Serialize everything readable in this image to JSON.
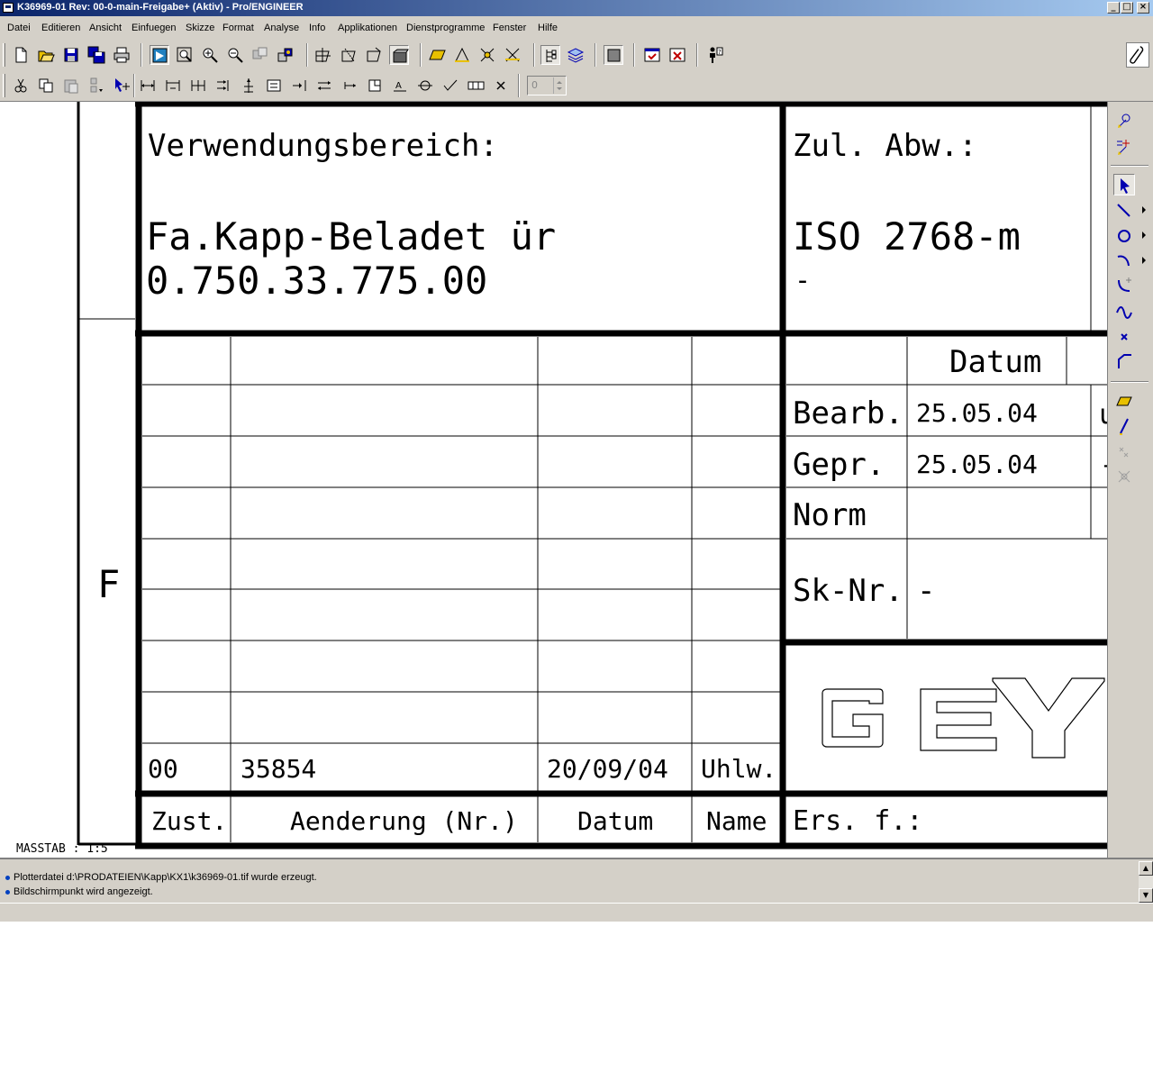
{
  "window": {
    "title": "K36969-01 Rev: 00-0-main-Freigabe+ (Aktiv) - Pro/ENGINEER",
    "minimize_glyph": "_",
    "maximize_glyph": "□",
    "close_glyph": "×"
  },
  "menu": [
    "Datei",
    "Editieren",
    "Ansicht",
    "Einfuegen",
    "Skizze",
    "Format",
    "Analyse",
    "Info",
    "Applikationen",
    "Dienstprogramme",
    "Fenster",
    "Hilfe"
  ],
  "toolbar1": [
    "new-file-icon",
    "open-folder-icon",
    "save-icon",
    "save-copy-icon",
    "print-icon",
    "repaint-icon",
    "refit-icon",
    "zoom-in-icon",
    "zoom-out-icon",
    "spin-center-icon",
    "layer-display-icon",
    "datum-planes-icon",
    "datum-axes-icon",
    "datum-points-icon",
    "coordinate-systems-icon",
    "sketch-plane-icon",
    "sketch-line-icon",
    "sketch-dimension-icon",
    "sketch-relation-icon",
    "tree-view-icon",
    "layer-tree-icon",
    "shading-icon",
    "window-activate-icon",
    "window-close-icon",
    "context-help-icon"
  ],
  "toolbar2": [
    "cut-icon",
    "copy-icon",
    "paste-icon",
    "select-filter-icon",
    "pick-icon",
    "dimension-icon",
    "ordinate-dimension-icon",
    "baseline-dimension-icon",
    "align-dimension-icon",
    "move-dimension-icon",
    "text-style-icon",
    "tab-icon",
    "flip-arrows-icon",
    "break-icon",
    "clip-icon",
    "note-icon",
    "symbol-icon",
    "check-icon",
    "table-icon",
    "delete-icon"
  ],
  "spinner": {
    "value": "0"
  },
  "right_toolbar": [
    "snap-icon",
    "grid-icon",
    "select-arrow-icon",
    "line-icon",
    "circle-icon",
    "arc-icon",
    "fillet-icon",
    "spline-icon",
    "point-icon",
    "chamfer-icon",
    "parallelogram-icon",
    "construction-line-icon",
    "intersect-icon",
    "trim-icon"
  ],
  "drawing": {
    "zone_letter": "F",
    "usage_label": "Verwendungsbereich:",
    "usage_line1": "Fa.Kapp-Beladet ür",
    "usage_line2": "0.750.33.775.00",
    "tolerance_label": "Zul. Abw.:",
    "tolerance_value": "ISO 2768-m",
    "tolerance_dash": "-",
    "truncated_right_char": "(",
    "datum_header": "Datum",
    "bearb_label": "Bearb.",
    "bearb_date": "25.05.04",
    "bearb_trunc": "u",
    "gepr_label": "Gepr.",
    "gepr_date": "25.05.04",
    "gepr_trunc": "-",
    "norm_label": "Norm",
    "sknr_label": "Sk-Nr.",
    "sknr_value": "-",
    "logo_text": "GEY",
    "revision": {
      "state": "00",
      "change_no": "35854",
      "date": "20/09/04",
      "name": "Uhlw."
    },
    "headers": {
      "state": "Zust.",
      "change": "Aenderung (Nr.)",
      "date": "Datum",
      "name": "Name"
    },
    "replacement_label": "Ers. f.:",
    "scale_label": "MASSTAB : 1:5"
  },
  "messages": [
    "Plotterdatei d:\\PRODATEIEN\\Kapp\\KX1\\k36969-01.tif wurde erzeugt.",
    "Bildschirmpunkt wird angezeigt."
  ],
  "colors": {
    "chrome": "#d4d0c8",
    "title_start": "#0a246a",
    "title_end": "#a6caf0",
    "icon_blue": "#0000b0",
    "icon_yellow": "#e8c000",
    "message_dot": "#0040c0"
  }
}
